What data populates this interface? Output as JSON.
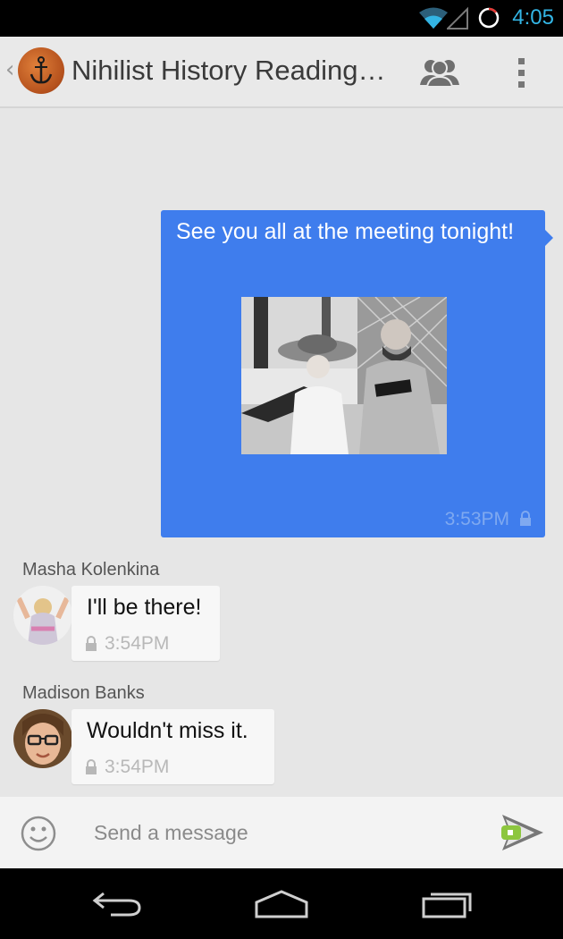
{
  "status_bar": {
    "time": "4:05"
  },
  "action_bar": {
    "title": "Nihilist History Reading…"
  },
  "messages": {
    "outgoing": {
      "text": "See you all at the meeting tonight!",
      "time": "3:53PM"
    },
    "incoming": [
      {
        "sender": "Masha Kolenkina",
        "text": "I'll be there!",
        "time": "3:54PM"
      },
      {
        "sender": "Madison Banks",
        "text": "Wouldn't miss it.",
        "time": "3:54PM"
      }
    ]
  },
  "composer": {
    "placeholder": "Send a message"
  },
  "colors": {
    "accent": "#33b5e5",
    "bubble_outgoing": "#3f7ded",
    "send_green": "#8dc63f"
  },
  "icons": [
    "wifi-icon",
    "signal-icon",
    "battery-icon",
    "people-icon",
    "overflow-menu-icon",
    "lock-icon",
    "emoji-icon",
    "send-icon",
    "back-nav-icon",
    "home-nav-icon",
    "recents-nav-icon"
  ]
}
